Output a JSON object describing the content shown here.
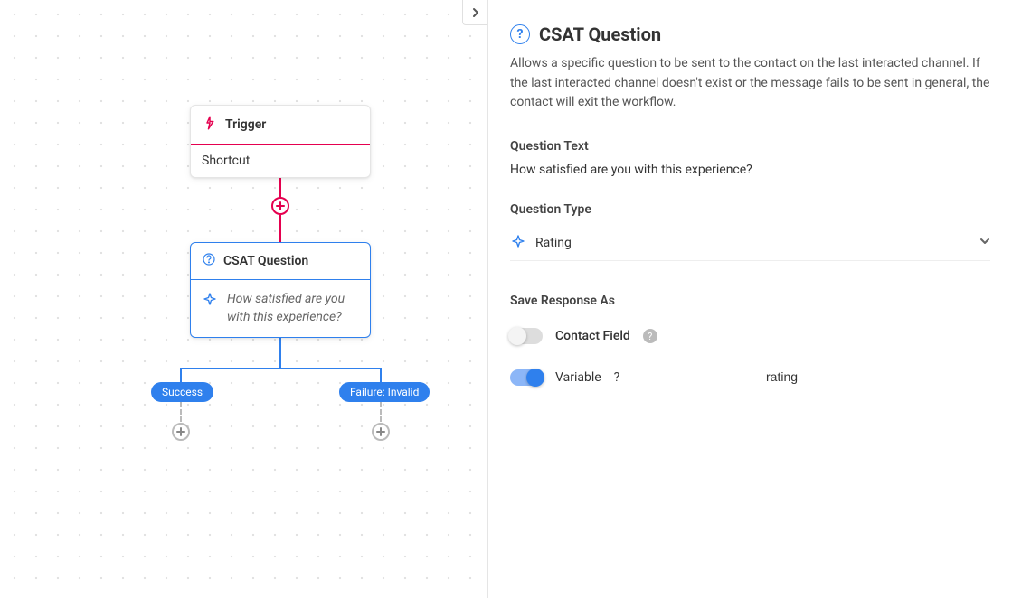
{
  "canvas": {
    "trigger": {
      "title": "Trigger",
      "body": "Shortcut"
    },
    "csat_node": {
      "title": "CSAT Question",
      "question": "How satisfied are you with this experience?"
    },
    "branches": {
      "success": "Success",
      "failure": "Failure: Invalid"
    }
  },
  "panel": {
    "title": "CSAT Question",
    "description": "Allows a specific question to be sent to the contact on the last interacted channel. If the last interacted channel doesn't exist or the message fails to be sent in general, the contact will exit the workflow.",
    "question_text_label": "Question Text",
    "question_text_value": "How satisfied are you with this experience?",
    "question_type_label": "Question Type",
    "question_type_value": "Rating",
    "save_response_label": "Save Response As",
    "contact_field_label": "Contact Field",
    "contact_field_on": false,
    "variable_label": "Variable",
    "variable_on": true,
    "variable_value": "rating"
  }
}
